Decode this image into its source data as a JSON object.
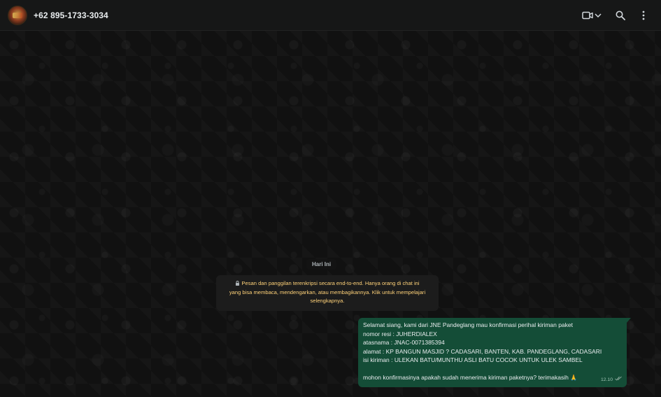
{
  "header": {
    "contact_name": "+62 895-1733-3034",
    "icons": [
      "video-call-icon",
      "chevron-down-icon",
      "search-icon",
      "menu-icon"
    ]
  },
  "chat": {
    "date_label": "Hari Ini",
    "encryption_notice": {
      "line1": "Pesan dan panggilan terenkripsi secara end-to-end. Hanya orang di chat ini",
      "line2": "yang bisa membaca, mendengarkan, atau membagikannya. Klik untuk mempelajari",
      "line3": "selengkapnya."
    },
    "message": {
      "lines": [
        "Selamat siang, kami dari JNE Pandeglang mau konfirmasi perihal kiriman paket",
        "nomor resi : JUHERDIALEX",
        "atasnama : JNAC-0071385394",
        "alamat : KP BANGUN MASJID ? CADASARI, BANTEN, KAB. PANDEGLANG, CADASARI",
        "isi kiriman : ULEKAN BATU/MUNTHU ASLI BATU COCOK UNTUK ULEK SAMBEL"
      ],
      "last_line": "mohon konfirmasinya apakah sudah menerima kiriman paketnya? terimakasih",
      "emoji": "🙏",
      "time": "12.10"
    }
  },
  "colors": {
    "header_bg": "#161717",
    "outgoing_bubble": "#144d37",
    "notice_text": "#ffd279",
    "text_primary": "#e9edef"
  }
}
